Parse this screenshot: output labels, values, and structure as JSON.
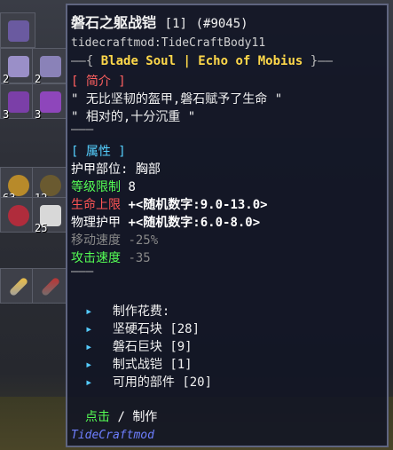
{
  "inventory": {
    "counts": [
      "2",
      "2",
      "3",
      "3",
      "63",
      "12",
      "25"
    ]
  },
  "tooltip": {
    "title": "磐石之躯战铠",
    "title_index": "[1]",
    "title_id": "(#9045)",
    "mod_id": "tidecraftmod:TideCraftBody11",
    "set_line": {
      "dash_left": "——{",
      "name": "Blade Soul | Echo of Mobius",
      "dash_right": "}——"
    },
    "intro_header": "[ 简介 ]",
    "intro_lines": [
      "\" 无比坚韧的盔甲,磐石赋予了生命 \"",
      "\" 相对的,十分沉重 \""
    ],
    "separator": "———",
    "attr_header": "[ 属性 ]",
    "slot_label": "护甲部位:",
    "slot_value": "胸部",
    "level_label": "等级限制",
    "level_value": "8",
    "hp_label": "生命上限",
    "hp_value": "+<随机数字:9.0-13.0>",
    "armor_label": "物理护甲",
    "armor_value": "+<随机数字:6.0-8.0>",
    "speed_label": "移动速度",
    "speed_value": "-25%",
    "atkspeed_label": "攻击速度",
    "atkspeed_value": "-35",
    "separator2": "———",
    "recipe_header": "制作花费:",
    "recipe_items": [
      {
        "name": "坚硬石块",
        "count": "[28]"
      },
      {
        "name": "磐石巨块",
        "count": "[9]"
      },
      {
        "name": "制式战铠",
        "count": "[1]"
      },
      {
        "name": "可用的部件",
        "count": "[20]"
      }
    ],
    "action_click": "点击",
    "action_slash": "/",
    "action_craft": "制作",
    "mod_name": "TideCraftmod"
  },
  "colors": {
    "set_gold": "#ffd84a",
    "header_red": "#ff6060",
    "attr_cyan": "#55d0ff",
    "stat_green": "#55ff55",
    "stat_red": "#ff5555",
    "stat_gray": "#888888",
    "mod_blue": "#6e7fff"
  }
}
